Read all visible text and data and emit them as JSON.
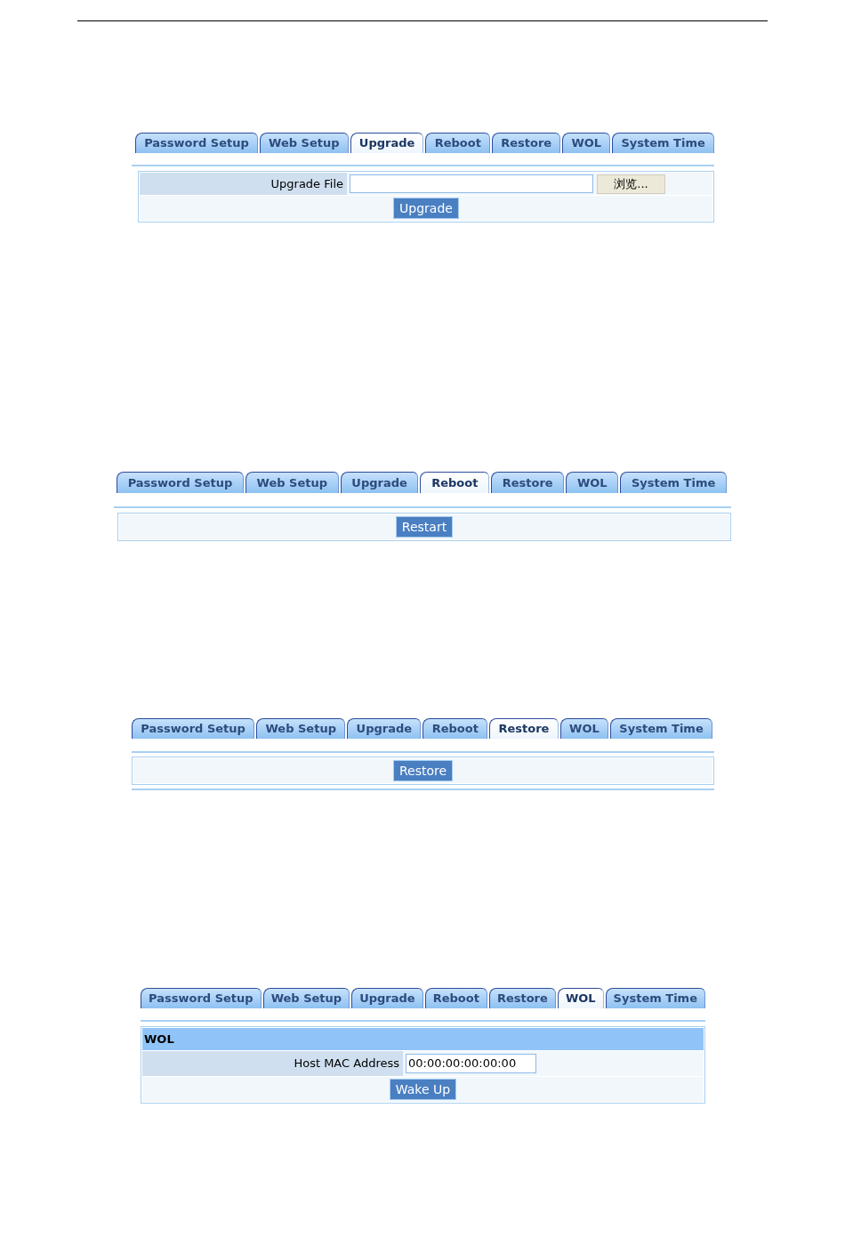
{
  "panels": [
    {
      "tabs": [
        {
          "label": "Password Setup",
          "selected": false
        },
        {
          "label": "Web Setup",
          "selected": false
        },
        {
          "label": "Upgrade",
          "selected": true
        },
        {
          "label": "Reboot",
          "selected": false
        },
        {
          "label": "Restore",
          "selected": false
        },
        {
          "label": "WOL",
          "selected": false
        },
        {
          "label": "System Time",
          "selected": false
        }
      ],
      "rows": [
        {
          "kind": "file",
          "label": "Upgrade File",
          "button": "浏览..."
        },
        {
          "kind": "action",
          "button": "Upgrade"
        }
      ]
    },
    {
      "tabs": [
        {
          "label": "Password Setup",
          "selected": false
        },
        {
          "label": "Web Setup",
          "selected": false
        },
        {
          "label": "Upgrade",
          "selected": false
        },
        {
          "label": "Reboot",
          "selected": true
        },
        {
          "label": "Restore",
          "selected": false
        },
        {
          "label": "WOL",
          "selected": false
        },
        {
          "label": "System Time",
          "selected": false
        }
      ],
      "rows": [
        {
          "kind": "action",
          "button": "Restart"
        }
      ]
    },
    {
      "tabs": [
        {
          "label": "Password Setup",
          "selected": false
        },
        {
          "label": "Web Setup",
          "selected": false
        },
        {
          "label": "Upgrade",
          "selected": false
        },
        {
          "label": "Reboot",
          "selected": false
        },
        {
          "label": "Restore",
          "selected": true
        },
        {
          "label": "WOL",
          "selected": false
        },
        {
          "label": "System Time",
          "selected": false
        }
      ],
      "rows": [
        {
          "kind": "action",
          "button": "Restore"
        }
      ]
    },
    {
      "tabs": [
        {
          "label": "Password Setup",
          "selected": false
        },
        {
          "label": "Web Setup",
          "selected": false
        },
        {
          "label": "Upgrade",
          "selected": false
        },
        {
          "label": "Reboot",
          "selected": false
        },
        {
          "label": "Restore",
          "selected": false
        },
        {
          "label": "WOL",
          "selected": true
        },
        {
          "label": "System Time",
          "selected": false
        }
      ],
      "rows": [
        {
          "kind": "header",
          "title": "WOL"
        },
        {
          "kind": "text",
          "label": "Host MAC Address",
          "value": "00:00:00:00:00:00"
        },
        {
          "kind": "action",
          "button": "Wake Up"
        }
      ]
    }
  ]
}
